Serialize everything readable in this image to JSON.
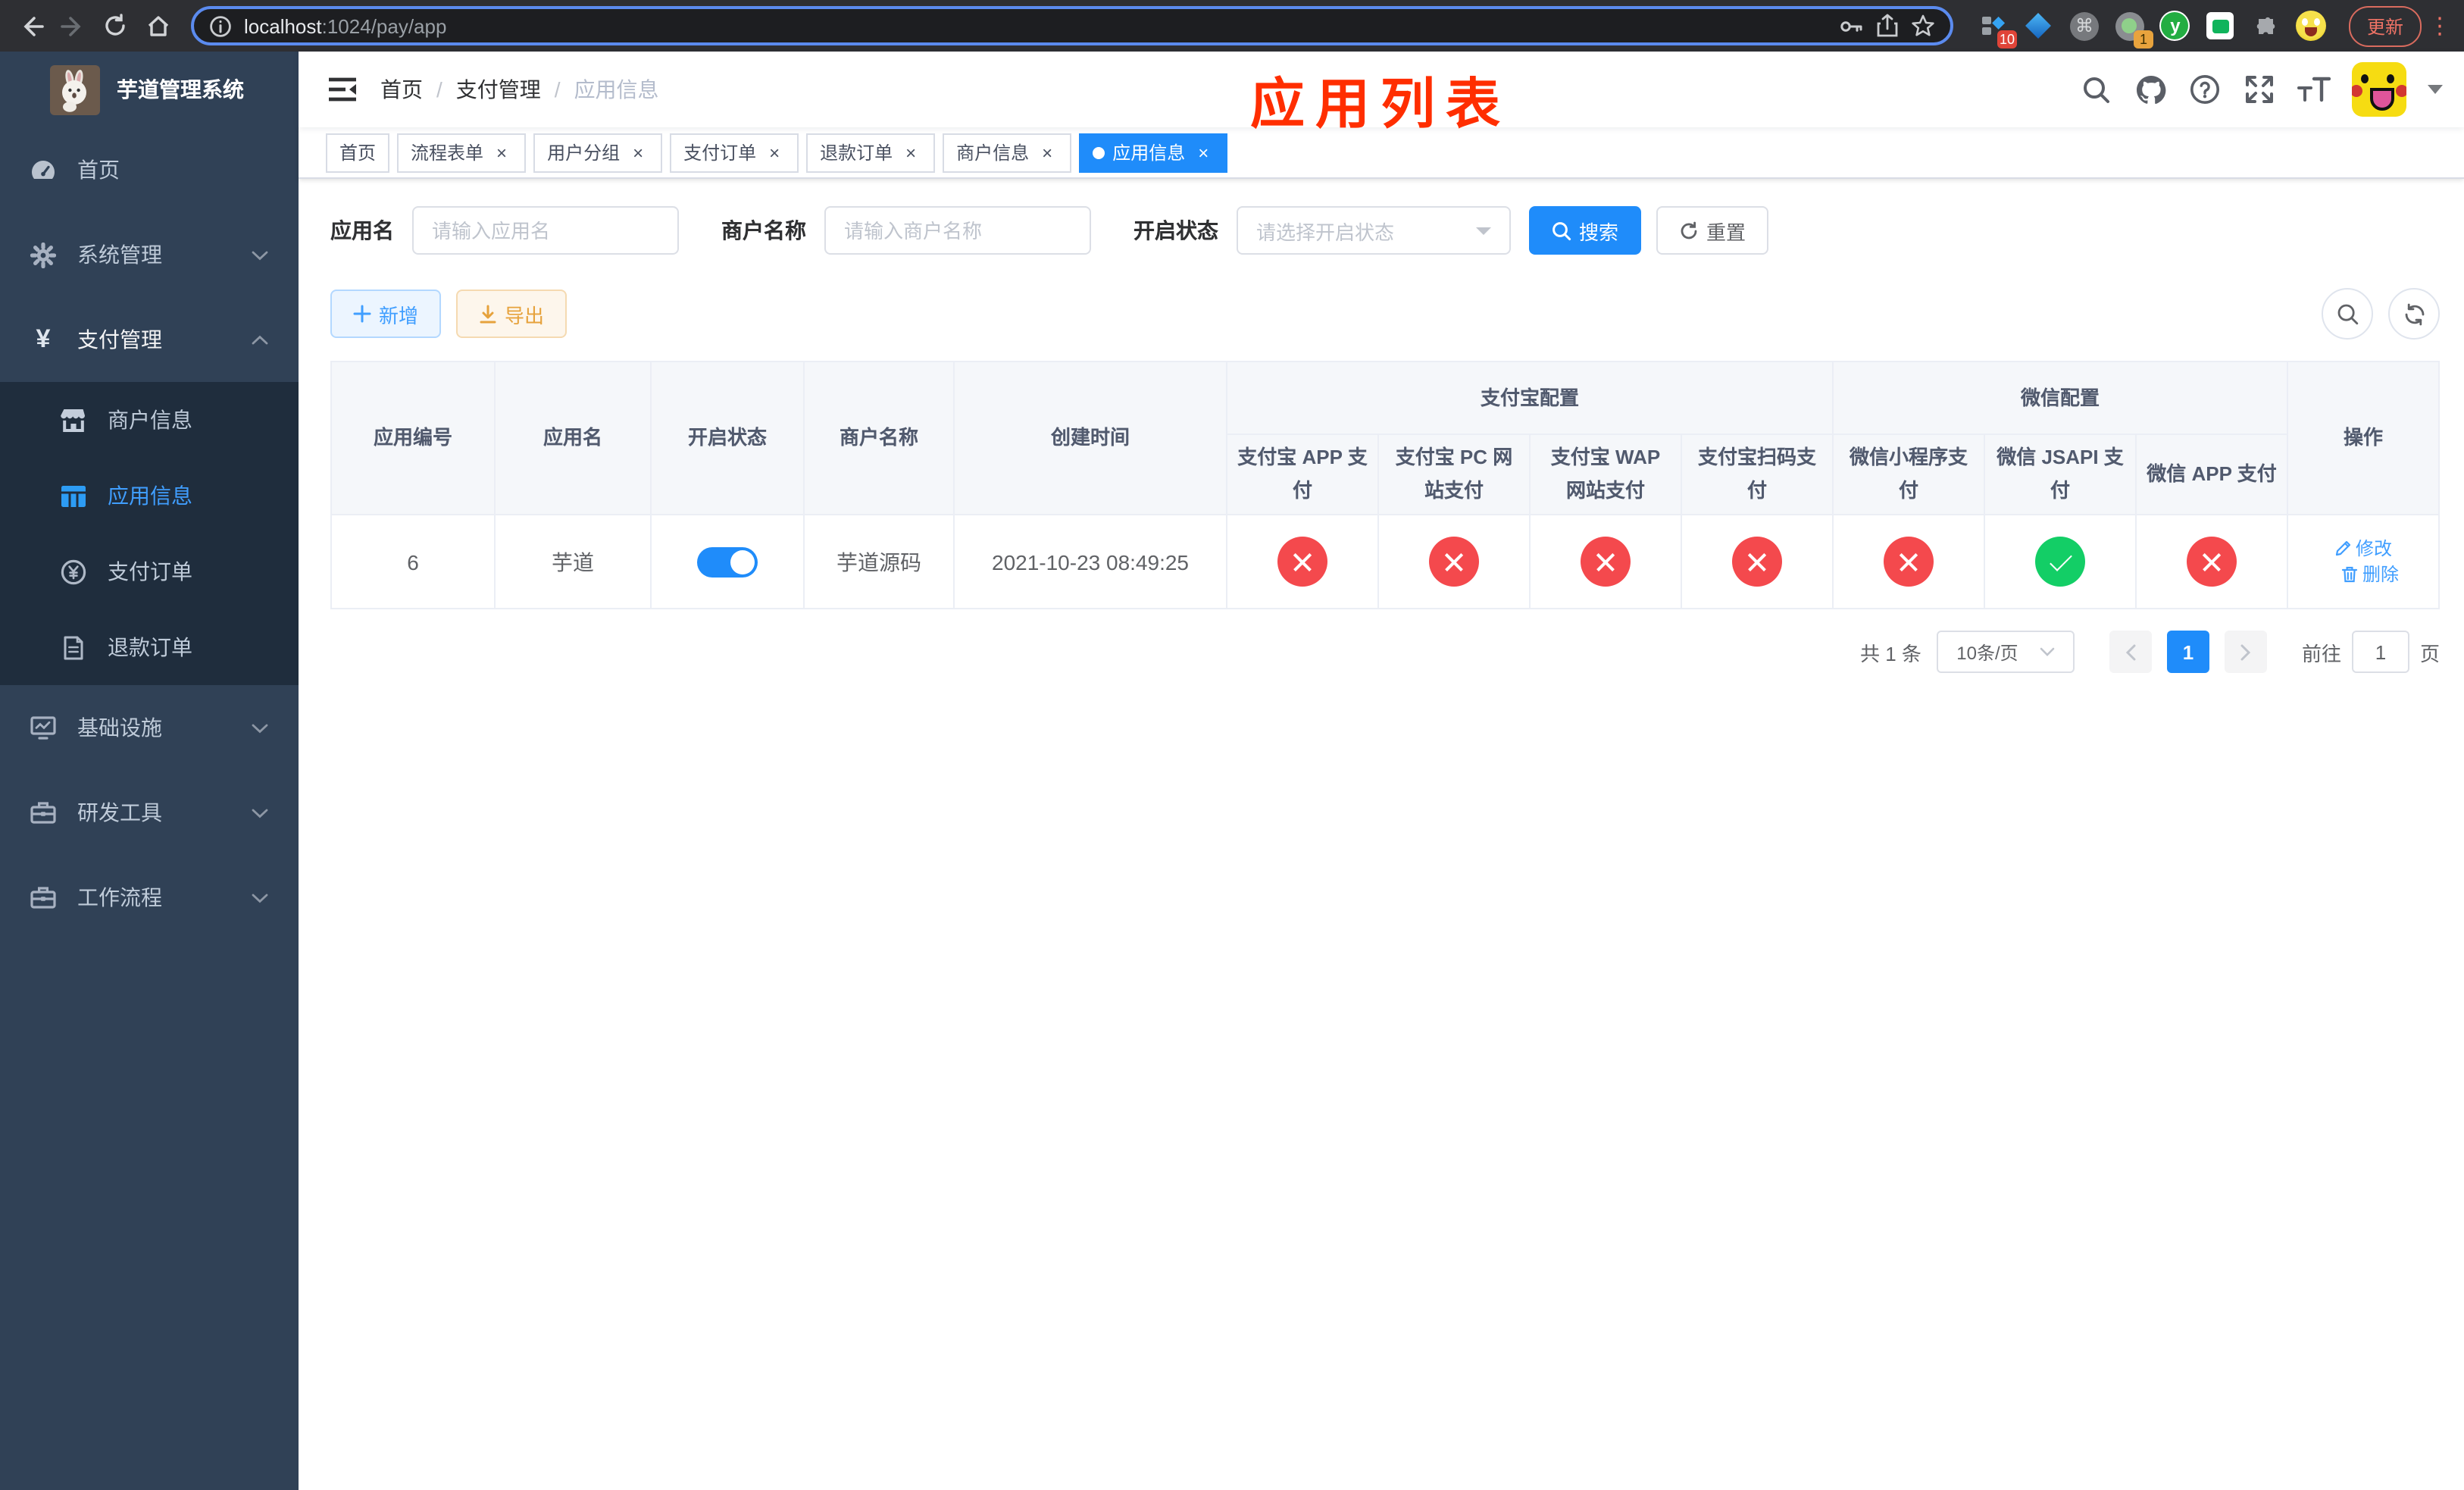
{
  "browser": {
    "url_host": "localhost",
    "url_path": ":1024/pay/app",
    "update_label": "更新",
    "ext_badge_blocks": "10",
    "ext_badge_record": "1",
    "ext_y_label": "y"
  },
  "sidebar": {
    "title": "芋道管理系统",
    "items": [
      {
        "label": "首页",
        "icon": "dashboard-icon",
        "expandable": false
      },
      {
        "label": "系统管理",
        "icon": "gear-icon",
        "expandable": true
      },
      {
        "label": "支付管理",
        "icon": "yen-icon",
        "expandable": true,
        "expanded": true
      },
      {
        "label": "基础设施",
        "icon": "monitor-icon",
        "expandable": true
      },
      {
        "label": "研发工具",
        "icon": "toolbox-icon",
        "expandable": true
      },
      {
        "label": "工作流程",
        "icon": "toolbox-icon",
        "expandable": true
      }
    ],
    "pay_children": [
      {
        "label": "商户信息",
        "icon": "shop-icon",
        "active": false
      },
      {
        "label": "应用信息",
        "icon": "grid-icon",
        "active": true
      },
      {
        "label": "支付订单",
        "icon": "yen-circle-icon",
        "active": false
      },
      {
        "label": "退款订单",
        "icon": "document-icon",
        "active": false
      }
    ]
  },
  "navbar": {
    "breadcrumb": [
      "首页",
      "支付管理",
      "应用信息"
    ],
    "annotation": "应用列表"
  },
  "tabs": [
    {
      "label": "首页",
      "closable": false,
      "active": false
    },
    {
      "label": "流程表单",
      "closable": true,
      "active": false
    },
    {
      "label": "用户分组",
      "closable": true,
      "active": false
    },
    {
      "label": "支付订单",
      "closable": true,
      "active": false
    },
    {
      "label": "退款订单",
      "closable": true,
      "active": false
    },
    {
      "label": "商户信息",
      "closable": true,
      "active": false
    },
    {
      "label": "应用信息",
      "closable": true,
      "active": true
    }
  ],
  "search_form": {
    "fields": [
      {
        "label": "应用名",
        "placeholder": "请输入应用名",
        "type": "input"
      },
      {
        "label": "商户名称",
        "placeholder": "请输入商户名称",
        "type": "input"
      },
      {
        "label": "开启状态",
        "placeholder": "请选择开启状态",
        "type": "select"
      }
    ],
    "search_label": "搜索",
    "reset_label": "重置"
  },
  "toolbar": {
    "add_label": "新增",
    "export_label": "导出"
  },
  "table": {
    "group_headers": {
      "alipay": "支付宝配置",
      "wechat": "微信配置"
    },
    "headers": {
      "app_id": "应用编号",
      "app_name": "应用名",
      "status": "开启状态",
      "merchant": "商户名称",
      "created": "创建时间",
      "operation": "操作"
    },
    "sub_headers": [
      "支付宝 APP 支付",
      "支付宝 PC 网站支付",
      "支付宝 WAP 网站支付",
      "支付宝扫码支付",
      "微信小程序支付",
      "微信 JSAPI 支付",
      "微信 APP 支付"
    ],
    "row": {
      "app_id": "6",
      "app_name": "芋道",
      "enabled": true,
      "merchant": "芋道源码",
      "created": "2021-10-23 08:49:25",
      "pay_channels": [
        false,
        false,
        false,
        false,
        false,
        true,
        false
      ],
      "edit_label": "修改",
      "delete_label": "删除"
    }
  },
  "pagination": {
    "total_text": "共 1 条",
    "page_size": "10条/页",
    "current_page": "1",
    "goto_label": "前往",
    "goto_value": "1",
    "page_unit": "页"
  },
  "colors": {
    "primary": "#1f8cfa",
    "link": "#409eff",
    "danger": "#f4494d",
    "success": "#13ce66",
    "warning": "#e6a23c",
    "annotation": "#ff2e00",
    "sidebar_bg": "#304156",
    "submenu_bg": "#1f2d3d"
  }
}
